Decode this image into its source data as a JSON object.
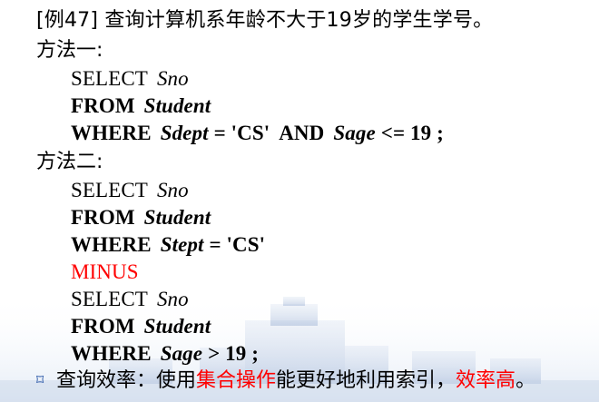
{
  "colors": {
    "background": "#ffffff",
    "text": "#000000",
    "accent_red": "#ff0000",
    "bullet_blue": "#1f4fa3"
  },
  "title": "[例47]  查询计算机系年龄不大于19岁的学生学号。",
  "method1": {
    "label": "方法一:",
    "lines": [
      {
        "kw": "SELECT",
        "arg": "Sno"
      },
      {
        "kw": "FROM",
        "arg": "Student"
      },
      {
        "kw": "WHERE",
        "field": "Sdept",
        "op": "= 'CS'",
        "conj": "AND",
        "field2": "Sage",
        "op2": "<= 19 ;"
      }
    ]
  },
  "method2": {
    "label": "方法二:",
    "lines": [
      {
        "kw": "SELECT",
        "arg": "Sno"
      },
      {
        "kw": "FROM",
        "arg": "Student"
      },
      {
        "kw": "WHERE",
        "field": "Stept",
        "op": "= 'CS'"
      },
      {
        "kw": "MINUS"
      },
      {
        "kw": "SELECT",
        "arg": "Sno"
      },
      {
        "kw": "FROM",
        "arg": "Student"
      },
      {
        "kw": "WHERE",
        "field": "Sage",
        "op": "> 19 ;"
      }
    ]
  },
  "note": {
    "icon": "bullet-icon",
    "prefix": "查询效率：使用",
    "highlight1": "集合操作",
    "middle": "能更好地利用索引，",
    "highlight2": "效率高",
    "suffix": "。"
  }
}
